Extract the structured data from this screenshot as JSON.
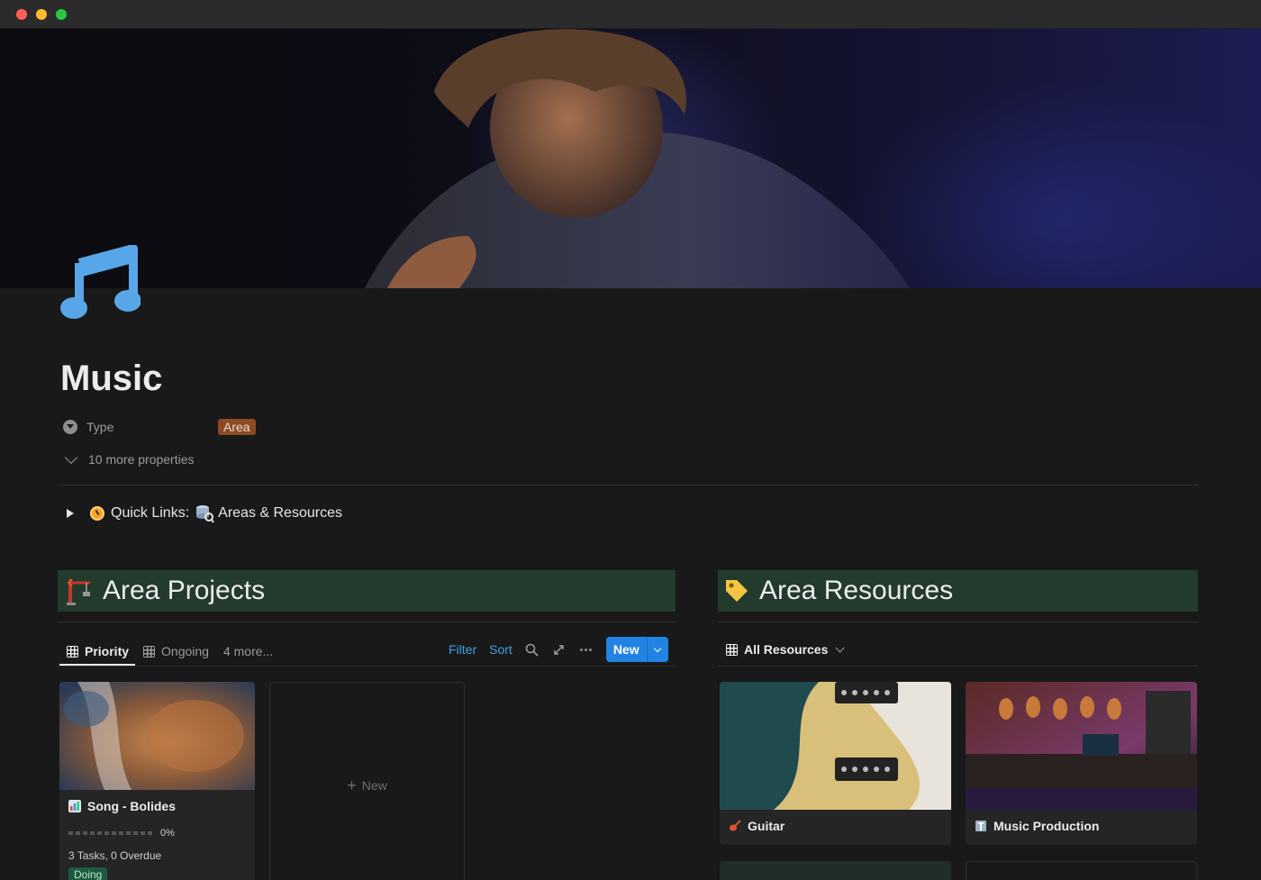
{
  "page": {
    "title": "Music",
    "icon": "music-note-icon",
    "properties": [
      {
        "label": "Type",
        "value": "Area",
        "color": "#8a4b25"
      }
    ],
    "more_properties": "10 more properties"
  },
  "quick_links": {
    "label": "Quick Links:",
    "link": "Areas & Resources"
  },
  "area_projects": {
    "heading": "Area Projects",
    "tabs": [
      "Priority",
      "Ongoing",
      "4 more..."
    ],
    "actions": {
      "filter": "Filter",
      "sort": "Sort",
      "new": "New"
    },
    "cards": [
      {
        "title": "Song - Bolides",
        "progress": "0%",
        "tasks": "3 Tasks, 0 Overdue",
        "status": "Doing"
      }
    ],
    "new_card": "New"
  },
  "area_resources": {
    "heading": "Area Resources",
    "view": "All Resources",
    "cards": [
      {
        "title": "Guitar"
      },
      {
        "title": "Music Production"
      }
    ]
  },
  "colors": {
    "accent": "#2383e2",
    "section_bg": "#233b2d",
    "link": "#3fa0e4"
  }
}
